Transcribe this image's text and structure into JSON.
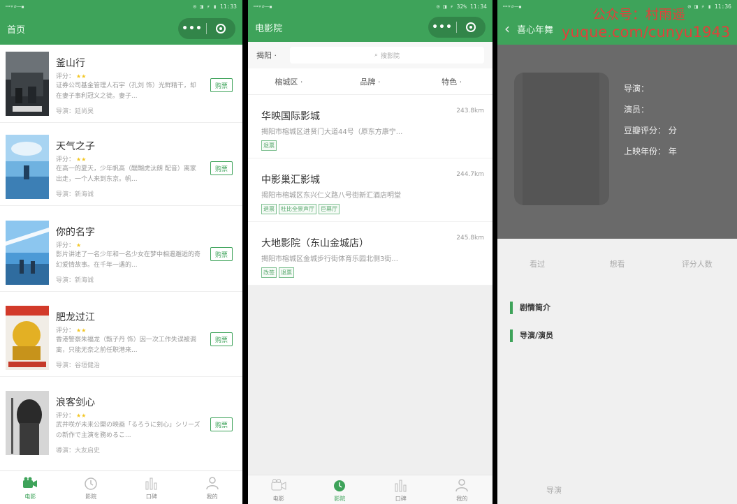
{
  "screen1": {
    "status": {
      "left": "ꟷ⌔⌕⏤⏹",
      "right": "⊙ ◨ ⚡ ▮ 11:33"
    },
    "header": {
      "title": "首页"
    },
    "movies": [
      {
        "title": "釜山行",
        "rating_label": "评分：",
        "stars": "★★",
        "desc": "证券公司基金管理人石宇（孔刘 饰）光鲜精干，却在妻子事利冠义之徒。妻子...",
        "director": "导演：延尚昊",
        "buy": "购票",
        "poster": "dark-train"
      },
      {
        "title": "天气之子",
        "rating_label": "评分：",
        "stars": "★★",
        "desc": "在高一的夏天，少年帆高（醍醐虎汰朗 配音）离家出走，一个人来到东京。帆...",
        "director": "导演：新海诚",
        "buy": "购票",
        "poster": "sky"
      },
      {
        "title": "你的名字",
        "rating_label": "评分：",
        "stars": "★",
        "desc": "影片讲述了一名少年和一名少女在梦中相遇邂逅的奇幻爱情故事。在千年一遇的...",
        "director": "导演：新海诚",
        "buy": "购票",
        "poster": "blue-sky"
      },
      {
        "title": "肥龙过江",
        "rating_label": "评分：",
        "stars": "★★",
        "desc": "香港警察朱福龙（甄子丹 饰）因一次工作失误被调离，只能无奈之前任职港来...",
        "director": "导演：谷垣健治",
        "buy": "购票",
        "poster": "yellow"
      },
      {
        "title": "浪客剑心",
        "rating_label": "评分：",
        "stars": "★★",
        "desc": "武井咲が未来公開の映画「るろうに剣心」シリーズの新作で主演を務めるこ...",
        "director": "導演：大友启史",
        "buy": "购票",
        "poster": "portrait"
      }
    ],
    "tabs": [
      {
        "label": "电影",
        "icon": "camera-icon",
        "active": true
      },
      {
        "label": "影院",
        "icon": "clock-icon",
        "active": false
      },
      {
        "label": "口碑",
        "icon": "bar-chart-icon",
        "active": false
      },
      {
        "label": "我的",
        "icon": "user-icon",
        "active": false
      }
    ]
  },
  "screen2": {
    "status": {
      "left": "ꟷ⌔⌕⏤⏹",
      "right": "⊙ ◨ ⚡ 32% 11:34"
    },
    "header": {
      "title": "电影院"
    },
    "search": {
      "city": "揭阳 ·",
      "placeholder": "搜影院"
    },
    "filters": [
      "榕城区 ·",
      "品牌 ·",
      "特色 ·"
    ],
    "cinemas": [
      {
        "name": "华映国际影城",
        "distance": "243.8km",
        "address": "揭阳市榕城区进贤门大道44号（原东方康宁...",
        "tags": [
          "退票"
        ]
      },
      {
        "name": "中影巢汇影城",
        "distance": "244.7km",
        "address": "揭阳市榕城区东兴仁义路八号街新汇酒店明堂",
        "tags": [
          "退票",
          "杜比全景声厅",
          "巨幕厅"
        ]
      },
      {
        "name": "大地影院（东山金城店）",
        "distance": "245.8km",
        "address": "揭阳市榕城区金城步行街体育乐园北侧3街...",
        "tags": [
          "改签",
          "退票"
        ]
      }
    ],
    "tabs": [
      {
        "label": "电影",
        "icon": "camera-icon",
        "active": false
      },
      {
        "label": "影院",
        "icon": "clock-icon",
        "active": true
      },
      {
        "label": "口碑",
        "icon": "bar-chart-icon",
        "active": false
      },
      {
        "label": "我的",
        "icon": "user-icon",
        "active": false
      }
    ]
  },
  "screen3": {
    "status": {
      "left": "ꟷ⌔⌕⏤⏹",
      "right": "⊙ ◨ ⚡ ▮ 11:36"
    },
    "header": {
      "back": "‹",
      "title": "喜心年舞"
    },
    "info": {
      "director": "导演：",
      "actors": "演员：",
      "rating": "豆瓣评分：  分",
      "year": "上映年份：  年"
    },
    "stats": [
      "看过",
      "想看",
      "评分人数"
    ],
    "sections": [
      "剧情简介",
      "导演/演员"
    ],
    "bottom": "导演"
  },
  "watermark": {
    "line1": "公众号：村雨遥",
    "line2": "yuque.com/cunyu1943"
  },
  "colors": {
    "accent": "#3ea35a",
    "watermark": "#e0413b"
  }
}
